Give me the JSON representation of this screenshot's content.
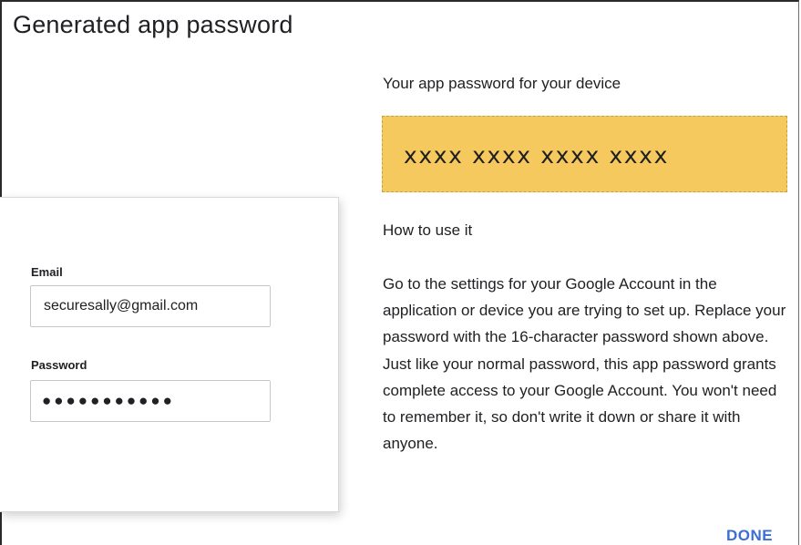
{
  "dialog": {
    "title": "Generated app password"
  },
  "login_card": {
    "email_label": "Email",
    "email_value": "securesally@gmail.com",
    "password_label": "Password",
    "password_mask": "●●●●●●●●●●●"
  },
  "right_panel": {
    "subheading": "Your app password for your device",
    "app_password": "xxxx xxxx xxxx xxxx",
    "password_box_color": "#f6c95f",
    "howto_heading": "How to use it",
    "paragraph_1": "Go to the settings for your Google Account in the application or device you are trying to set up. Replace your password with the 16-character password shown above.",
    "paragraph_2": "Just like your normal password, this app password grants complete access to your Google Account. You won't need to remember it, so don't write it down or share it with anyone.",
    "done_label": "DONE",
    "done_color": "#3c6fd1"
  }
}
